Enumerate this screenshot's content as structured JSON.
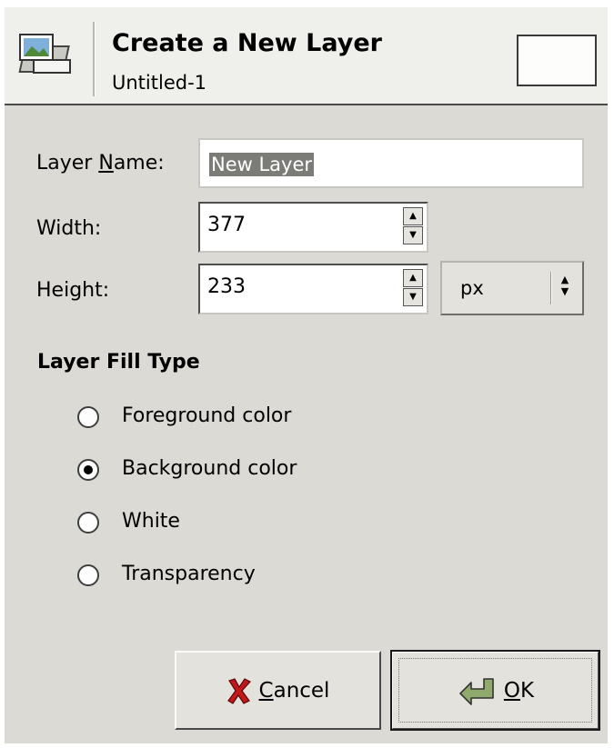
{
  "header": {
    "title": "Create a New Layer",
    "subtitle": "Untitled-1",
    "icon": "new-layer-icon"
  },
  "form": {
    "layer_name_label_prefix": "Layer ",
    "layer_name_label_mnemonic": "N",
    "layer_name_label_suffix": "ame:",
    "layer_name_value": "New Layer",
    "width_label": "Width:",
    "width_value": "377",
    "height_label": "Height:",
    "height_value": "233",
    "unit_value": "px"
  },
  "fill": {
    "title": "Layer Fill Type",
    "options": [
      {
        "label": "Foreground color",
        "selected": false
      },
      {
        "label": "Background color",
        "selected": true
      },
      {
        "label": "White",
        "selected": false
      },
      {
        "label": "Transparency",
        "selected": false
      }
    ]
  },
  "buttons": {
    "cancel_mnemonic": "C",
    "cancel_rest": "ancel",
    "ok_mnemonic": "O",
    "ok_rest": "K"
  },
  "colors": {
    "dialog_bg": "#dcdad5",
    "header_bg": "#efefeb",
    "selection_bg": "#7b7b78"
  }
}
